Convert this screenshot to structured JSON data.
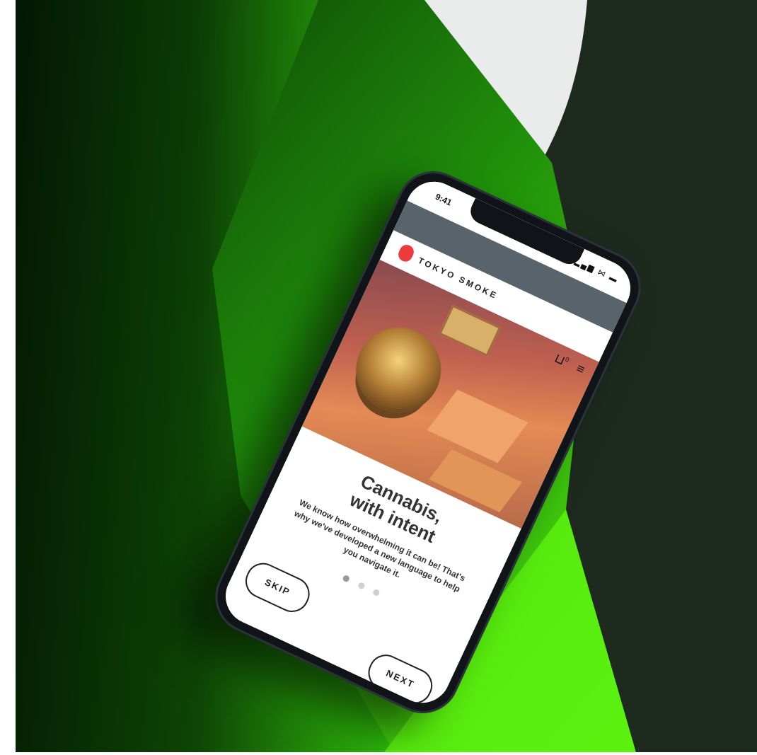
{
  "status_bar": {
    "time": "9:41",
    "indicators": "▂▄▆ ⋈ ▬"
  },
  "brand": {
    "name": "TOKYO SMOKE",
    "logo_color": "#ee3b3b"
  },
  "header_icons": {
    "cart_badge": "0",
    "cart_icon": "cart-icon",
    "menu_icon": "menu-icon"
  },
  "hero": {
    "alt": ""
  },
  "onboarding": {
    "title_line1": "Cannabis,",
    "title_line2": "with intent",
    "body": "We know how overwhelming it can be! That's why we've developed a new language to help you navigate it.",
    "page_count": 3,
    "active_page": 1,
    "skip_label": "SKIP",
    "next_label": "NEXT"
  },
  "colors": {
    "background_green": "#39d10a",
    "topbar_gray": "#59636c",
    "phone_body": "#101418"
  }
}
